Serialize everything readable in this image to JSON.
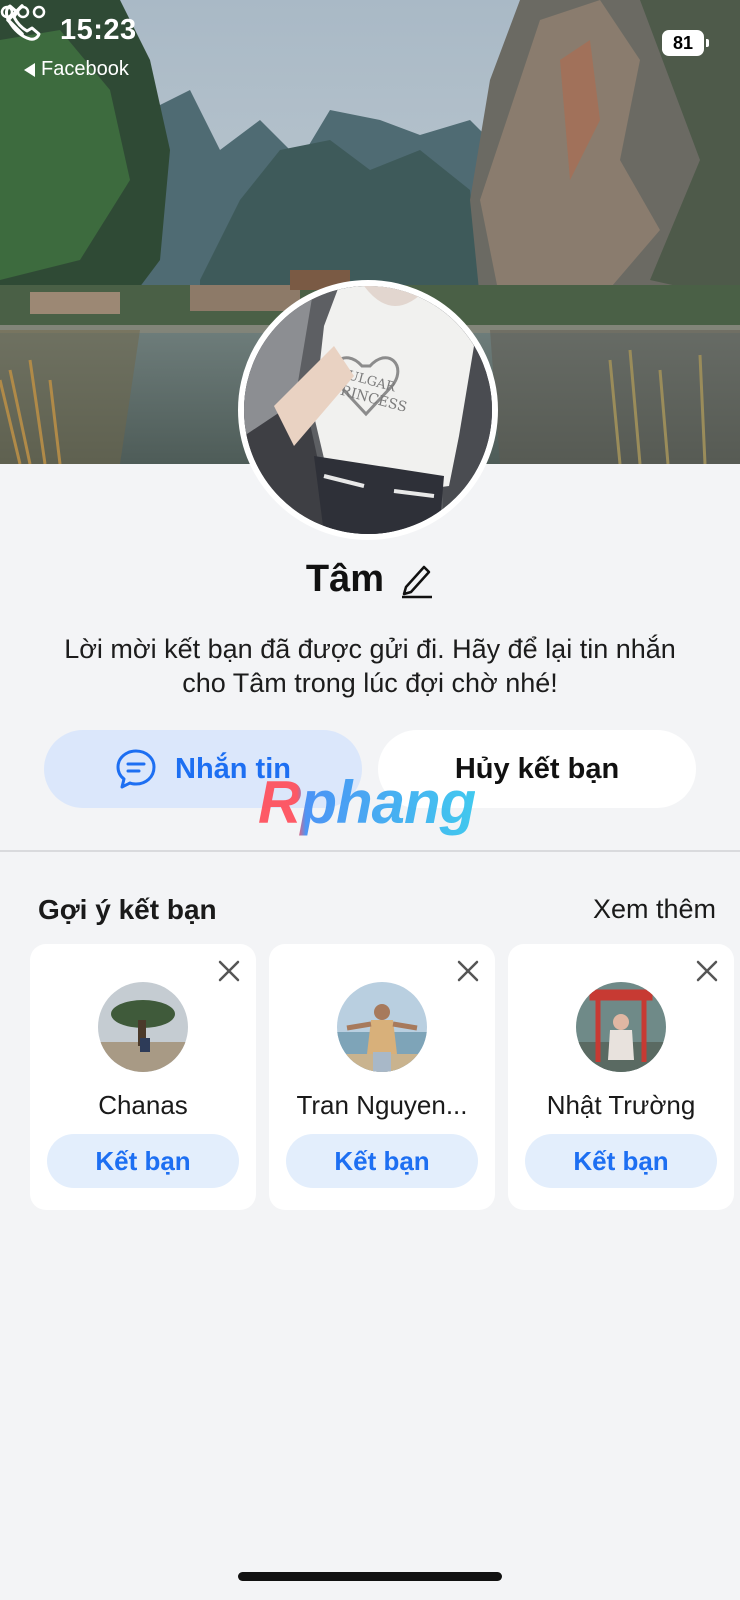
{
  "status_bar": {
    "time": "15:23",
    "back_app": "Facebook",
    "battery": "81"
  },
  "profile": {
    "name": "Tâm",
    "info_line1": "Lời mời kết bạn đã được gửi đi. Hãy để lại tin nhắn",
    "info_line2": "cho Tâm trong lúc đợi chờ nhé!",
    "avatar_shirt_text1": "VULGAR",
    "avatar_shirt_text2": "PRINCESS"
  },
  "actions": {
    "message_label": "Nhắn tin",
    "unfriend_label": "Hủy kết bạn"
  },
  "watermark": "Rphang",
  "suggestions": {
    "title": "Gợi ý kết bạn",
    "see_more": "Xem thêm",
    "items": [
      {
        "name": "Chanas",
        "button": "Kết bạn"
      },
      {
        "name": "Tran Nguyen...",
        "button": "Kết bạn"
      },
      {
        "name": "Nhật Trường",
        "button": "Kết bạn"
      }
    ]
  },
  "colors": {
    "accent": "#1d6ff2",
    "accent_soft": "#dbe7fb",
    "background": "#f3f4f6"
  },
  "icons": [
    "back-chevron-icon",
    "phone-icon",
    "more-icon",
    "edit-pencil-icon",
    "message-bubble-icon",
    "close-icon"
  ]
}
